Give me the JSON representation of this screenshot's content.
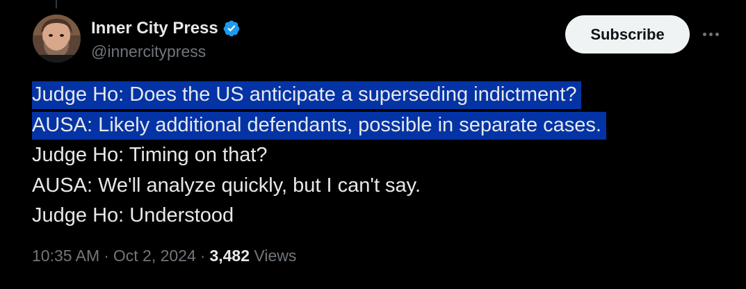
{
  "author": {
    "display_name": "Inner City Press",
    "handle": "@innercitypress",
    "verified_icon": "verified-badge-icon",
    "avatar": "profile-photo"
  },
  "actions": {
    "subscribe_label": "Subscribe",
    "more_icon": "more-options-icon"
  },
  "tweet": {
    "lines": [
      "Judge Ho: Does the US anticipate a superseding indictment?",
      "AUSA: Likely additional defendants, possible in separate cases.",
      "Judge Ho: Timing on that?",
      "AUSA: We'll analyze quickly, but I can't say.",
      "Judge Ho: Understood"
    ],
    "highlighted_lines": [
      0,
      1
    ]
  },
  "meta": {
    "time": "10:35 AM",
    "separator": "·",
    "date": "Oct 2, 2024",
    "views_count": "3,482",
    "views_label": "Views"
  },
  "colors": {
    "background": "#000000",
    "text": "#e7e9ea",
    "secondary_text": "#71767b",
    "highlight": "#0433a6",
    "verified": "#1d9bf0",
    "button_bg": "#eff3f4"
  }
}
